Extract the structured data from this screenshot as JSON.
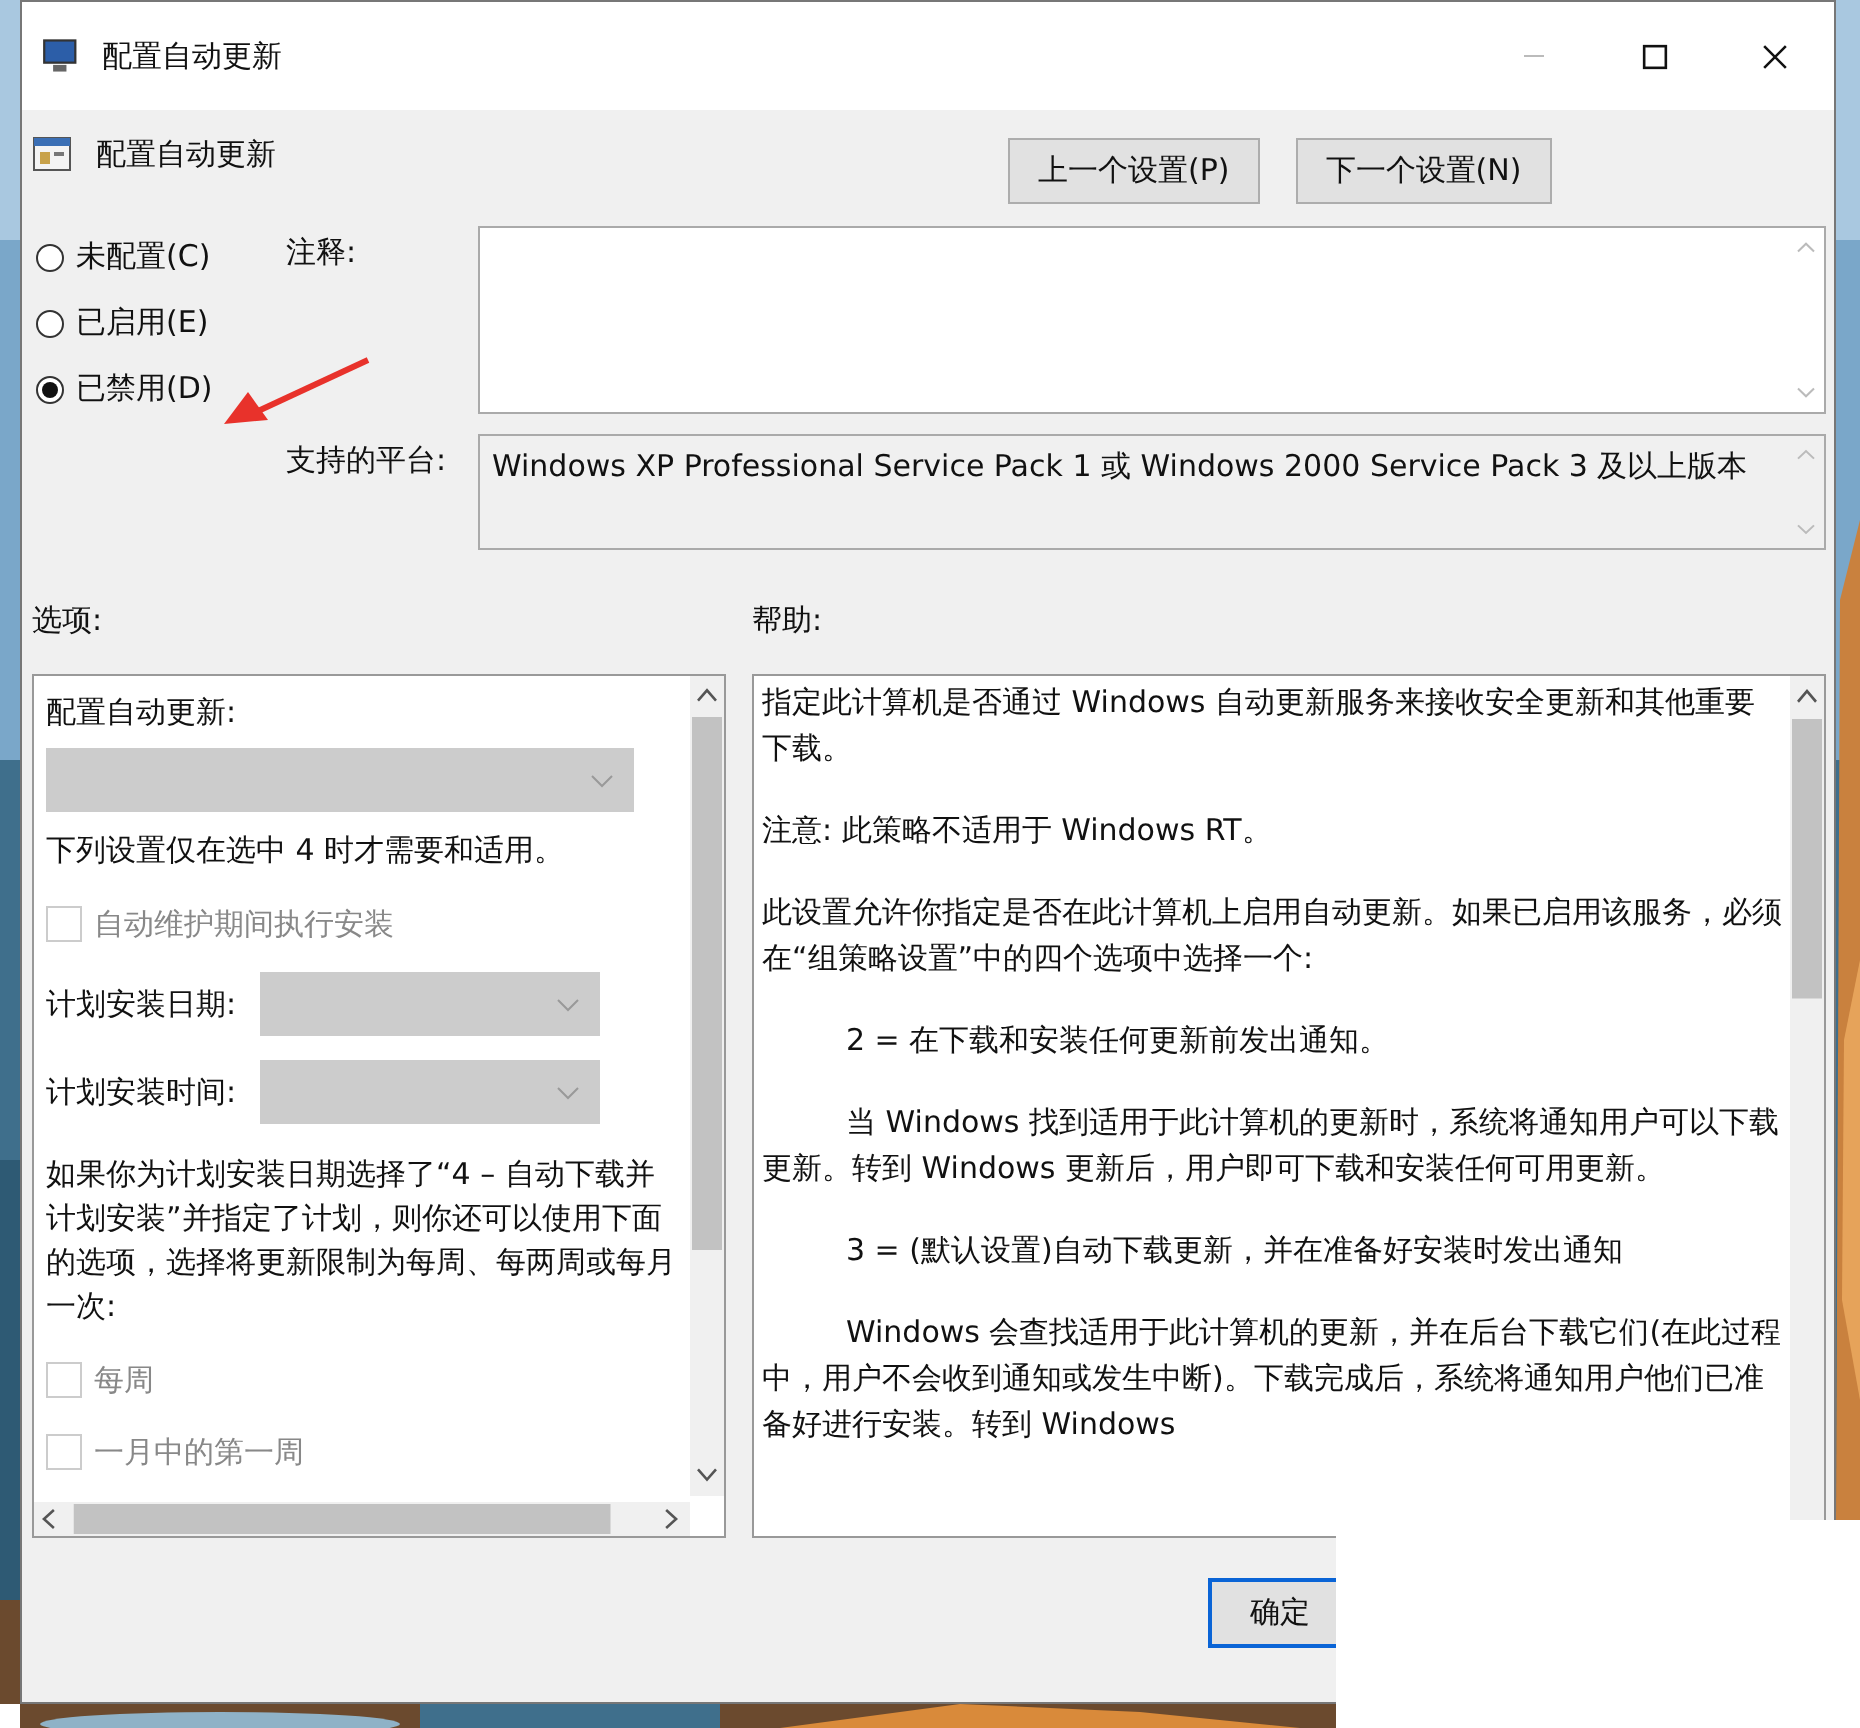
{
  "window": {
    "title": "配置自动更新"
  },
  "header": {
    "title": "配置自动更新"
  },
  "nav_buttons": [
    "上一个设置(P)",
    "下一个设置(N)"
  ],
  "state_options": [
    {
      "label": "未配置(C)",
      "selected": false
    },
    {
      "label": "已启用(E)",
      "selected": false
    },
    {
      "label": "已禁用(D)",
      "selected": true
    }
  ],
  "comment": {
    "label": "注释:"
  },
  "platform": {
    "label": "支持的平台:",
    "value": "Windows XP Professional Service Pack 1 或 Windows 2000 Service Pack 3 及以上版本"
  },
  "options": {
    "label": "选项:",
    "items": [
      {
        "kind": "label",
        "text": "配置自动更新:"
      },
      {
        "kind": "dropdown",
        "disabled": true
      },
      {
        "kind": "note",
        "text": "下列设置仅在选中 4 时才需要和适用。"
      },
      {
        "kind": "checkbox",
        "text": "自动维护期间执行安装",
        "checked": false,
        "disabled": true
      },
      {
        "kind": "labeled_dropdown",
        "text": "计划安装日期:",
        "disabled": true
      },
      {
        "kind": "labeled_dropdown",
        "text": "计划安装时间:",
        "disabled": true
      },
      {
        "kind": "note",
        "text": "如果你为计划安装日期选择了“4 – 自动下载并计划安装”并指定了计划，则你还可以使用下面的选项，选择将更新限制为每周、每两周或每月一次:"
      },
      {
        "kind": "checkbox",
        "text": "每周",
        "checked": false,
        "disabled": true
      },
      {
        "kind": "checkbox",
        "text": "一月中的第一周",
        "checked": false,
        "disabled": true
      }
    ]
  },
  "help": {
    "label": "帮助:",
    "paragraphs": [
      {
        "text": "指定此计算机是否通过 Windows 自动更新服务来接收安全更新和其他重要下载。",
        "indented": false
      },
      {
        "text": "注意: 此策略不适用于 Windows RT。",
        "indented": false
      },
      {
        "text": "此设置允许你指定是否在此计算机上启用自动更新。如果已启用该服务，必须在“组策略设置”中的四个选项中选择一个:",
        "indented": false
      },
      {
        "text": "2 = 在下载和安装任何更新前发出通知。",
        "indented": true
      },
      {
        "text": "当 Windows 找到适用于此计算机的更新时，系统将通知用户可以下载更新。转到 Windows 更新后，用户即可下载和安装任何可用更新。",
        "indented": true
      },
      {
        "text": "3 = (默认设置)自动下载更新，并在准备好安装时发出通知",
        "indented": true
      },
      {
        "text": "Windows 会查找适用于此计算机的更新，并在后台下载它们(在此过程中，用户不会收到通知或发生中断)。下载完成后，系统将通知用户他们已准备好进行安装。转到 Windows",
        "indented": true
      }
    ]
  },
  "footer_buttons": [
    "确定"
  ]
}
